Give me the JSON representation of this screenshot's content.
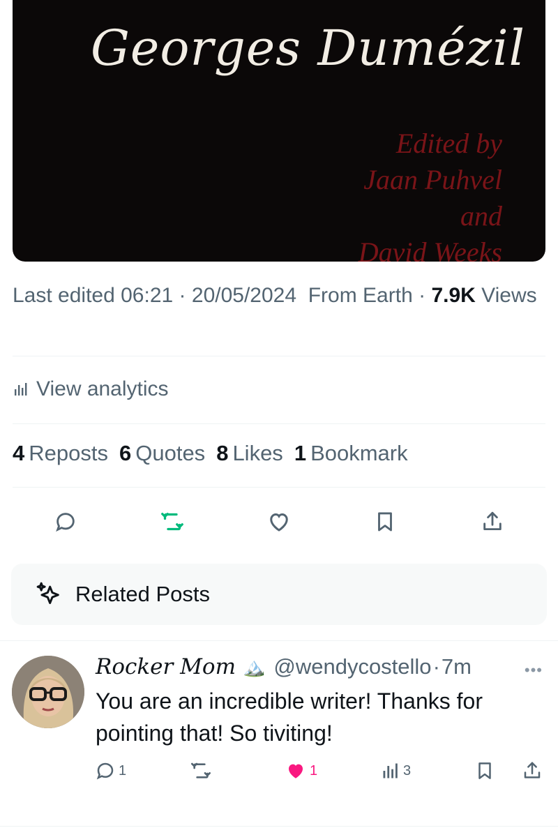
{
  "media": {
    "author": "Georges Dumézil",
    "editors": [
      "Edited by",
      "Jaan Puhvel",
      "and",
      "David Weeks"
    ]
  },
  "meta": {
    "last_edited_label": "Last edited",
    "time": "06:21",
    "separator": "·",
    "date": "20/05/2024",
    "location": "From Earth",
    "views_count": "7.9K",
    "views_label": "Views"
  },
  "analytics": {
    "label": "View analytics"
  },
  "stats": [
    {
      "count": "4",
      "label": "Reposts"
    },
    {
      "count": "6",
      "label": "Quotes"
    },
    {
      "count": "8",
      "label": "Likes"
    },
    {
      "count": "1",
      "label": "Bookmark"
    }
  ],
  "actions": {
    "icons": [
      "reply-icon",
      "repost-icon",
      "like-icon",
      "bookmark-icon",
      "share-icon"
    ],
    "repost_color": "#00ba7c"
  },
  "related": {
    "label": "Related Posts",
    "icon": "sparkle-icon"
  },
  "reply": {
    "name": "Rocker Mom",
    "name_emoji": "🏔️",
    "handle": "@wendycostello",
    "separator": "·",
    "time": "7m",
    "more": "•••",
    "text": "You are an incredible writer! Thanks for pointing that! So tiviting!",
    "counts": {
      "replies": "1",
      "reposts": "",
      "likes": "1",
      "views": "3"
    },
    "like_color": "#f91880"
  }
}
